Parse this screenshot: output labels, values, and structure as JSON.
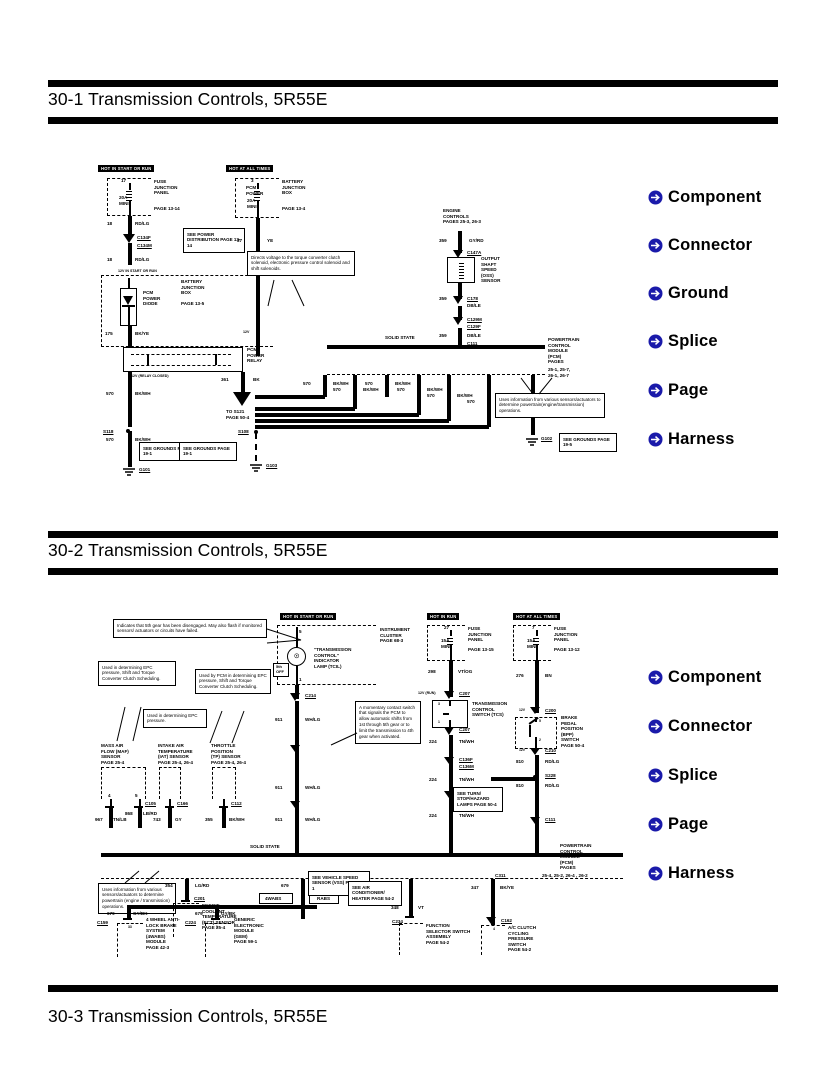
{
  "document": {
    "sections": [
      {
        "id": "30-1",
        "title": "30-1 Transmission Controls, 5R55E"
      },
      {
        "id": "30-2",
        "title": "30-2 Transmission Controls, 5R55E"
      },
      {
        "id": "30-3",
        "title": "30-3 Transmission Controls, 5R55E"
      }
    ]
  },
  "legend_top": {
    "items": [
      {
        "label": "Component"
      },
      {
        "label": "Connector"
      },
      {
        "label": "Ground"
      },
      {
        "label": "Splice"
      },
      {
        "label": "Page"
      },
      {
        "label": "Harness"
      }
    ],
    "bullet_icon": "arrow-circle-icon",
    "bullet_color": "#1a1aaa"
  },
  "legend_bottom": {
    "items": [
      {
        "label": "Component"
      },
      {
        "label": "Connector"
      },
      {
        "label": "Splice"
      },
      {
        "label": "Page"
      },
      {
        "label": "Harness"
      }
    ],
    "bullet_icon": "arrow-circle-icon",
    "bullet_color": "#1a1aaa"
  },
  "diagram1": {
    "hot_labels": {
      "start_or_run": "HOT IN START OR RUN",
      "all_times": "HOT AT ALL TIMES"
    },
    "fuse_junction_panel": {
      "name": "FUSE\nJUNCTION\nPANEL",
      "page": "PAGE 13-14",
      "fuse_num": "17",
      "fuse_rating": "20A\nMINI"
    },
    "battery_junction_box_top": {
      "name": "BATTERY\nJUNCTION\nBOX",
      "page": "PAGE 13-4",
      "fuse_num": "3",
      "fuse_label": "PCM\nPOWER",
      "fuse_rating": "20A\nMINI"
    },
    "see_power_distribution": "SEE POWER\nDISTRIBUTION\nPAGE 13-14",
    "battery_junction_box_diode": {
      "name": "BATTERY\nJUNCTION\nBOX",
      "page": "PAGE 13-5"
    },
    "pcm_power_diode": "PCM\nPOWER\nDIODE",
    "pcm_power_relay": "PCM\nPOWER\nRELAY",
    "engine_controls": "ENGINE\nCONTROLS\nPAGES 25-3, 26-3",
    "oss_sensor": "OUTPUT\nSHAFT\nSPEED\n(OSS)\nSENSOR",
    "pcm": {
      "name": "POWERTRAIN\nCONTROL\nMODULE\n(PCM)\nPAGES",
      "pages": "25-1, 25-7,\n26-1, 26-7"
    },
    "solid_state_label": "SOLID STATE",
    "note_directs_voltage": "Directs voltage to the torque converter clutch solenoid, electronic pressure control solenoid and shift solenoids.",
    "note_uses_information": "Uses information from various sensors/actuators to determine powertrain(engine/transmission) operations.",
    "see_grounds_1": "SEE GROUNDS\nPAGE 19-1",
    "see_grounds_2": "SEE GROUNDS\nPAGE 19-1",
    "see_grounds_3": "SEE GROUNDS\nPAGE 19-5",
    "to_s121": "TO S121\nPAGE 50-4",
    "hot_start_run_inline": "12V IN START OR RUN",
    "relay_closed_label": "12V (RELAY CLOSED)",
    "wires": [
      {
        "num": "18",
        "color": "RD/LG"
      },
      {
        "num": "18",
        "color": "RD/LG"
      },
      {
        "num": "175",
        "color": "BK/YE"
      },
      {
        "num": "37",
        "color": "YE"
      },
      {
        "num": "359",
        "color": "GY/RD"
      },
      {
        "num": "359",
        "color": "DB/LE"
      },
      {
        "num": "359",
        "color": "DB/LE"
      },
      {
        "num": "361",
        "color": "BK"
      },
      {
        "num": "570",
        "color": "BK/WH"
      },
      {
        "num": "570",
        "color": "BK/WH"
      },
      {
        "num": "570",
        "color": "BK/WH"
      },
      {
        "num": "570",
        "color": "BK/WH"
      },
      {
        "num": "570",
        "color": "BK/WH"
      },
      {
        "num": "570",
        "color": "BK/WH"
      },
      {
        "num": "570",
        "color": "BK/WH"
      },
      {
        "num": "570",
        "color": "BK/WH"
      },
      {
        "num": "570",
        "color": "BK/WH"
      },
      {
        "num": "57",
        "color": "BK"
      }
    ],
    "connectors": [
      "C134F",
      "C134M",
      "C147A",
      "C178",
      "C129M",
      "C129F",
      "C111",
      "C111"
    ],
    "splices": [
      "S118",
      "S108"
    ],
    "grounds": [
      "G101",
      "G103",
      "G102"
    ]
  },
  "diagram2": {
    "hot_labels": {
      "start_or_run": "HOT IN START OR RUN",
      "in_run": "HOT IN RUN",
      "all_times": "HOT AT ALL TIMES"
    },
    "note_tcil": "Indicates that 5th gear has been disengaged.  May also flash if monitored sensors/ actuators or circuits have failed.",
    "note_epc_left": "Used in determining EPC pressure, Shift and Torque Converter Clutch Scheduling.",
    "note_epc_mid": "Used by PCM in determining EPC pressure, Shift and Torque Converter Clutch Scheduling.",
    "note_iat": "Used in determining EPC pressure.",
    "note_momentary": "A momentary contact switch that signals the PCM to allow automatic shifts from 1st through 5th gear or to limit the transmission to 4th gear when activated.",
    "note_uses_information": "Uses information from various sensors/actuators to determine powertrain (engine / transmission) operations.",
    "instrument_cluster": "INSTRUMENT\nCLUSTER\nPAGE 68-3",
    "tcil": "\"TRANSMISSION\nCONTROL\"\nINDICATOR\nLAMP (TCIL)",
    "tcil_state": "5th\nOFF",
    "maf_sensor": "MASS AIR\nFLOW (MAF)\nSENSOR\nPAGE 25-4",
    "iat_sensor": "INTAKE AIR\nTEMPERATURE\n(IAT) SENSOR\nPAGE 25-4, 26-4",
    "tp_sensor": "THROTTLE\nPOSITION\n(TP) SENSOR\nPAGE 25-4, 26-4",
    "fuse_junction_panel_run": {
      "name": "FUSE\nJUNCTION\nPANEL",
      "page": "PAGE 13-15",
      "fuse_num": "27",
      "fuse_rating": "15A\nMINI"
    },
    "fuse_junction_panel_all": {
      "name": "FUSE\nJUNCTION\nPANEL",
      "page": "PAGE 13-12",
      "fuse_num": "7",
      "fuse_rating": "15A\nMINI"
    },
    "tcs": "TRANSMISSION\nCONTROL\nSWITCH (TCS)",
    "bpp_switch": "BRAKE\nPEDAL\nPOSITION\n(BPP)\nSWITCH\nPAGE 50-4",
    "see_turn_stop": "SEE TURN/\nSTOP/HAZARD\nLAMPS\nPAGE 50-4",
    "pcm": {
      "name": "POWERTRAIN\nCONTROL\nMODULE\n(PCM)\nPAGES",
      "pages": "25-4, 25-2, 26-4 , 26-2"
    },
    "solid_state_label": "SOLID STATE",
    "ect_sensor": "ENGINE\nCOOLANT\nTEMPERATURE\n(ECT) SENSOR\nPAGE 25-4",
    "abs_module": "4 WHEEL ANTI-\nLOCK BRAKE\nSYSTEM\n(4WABS)\nMODULE\nPAGE 42-3",
    "gem_module": "GENERIC\nELECTRONIC\nMODULE\n(GEM)\nPAGE 59-1",
    "see_vss": "SEE VEHICLE\nSPEED SENSOR\n(VSS)\nPAGE 64-1",
    "see_ac_heater": "SEE AIR\nCONDITIONER/\nHEATER\nPAGE 54-2",
    "function_selector": "FUNCTION\nSELECTOR SWITCH\nASSEMBLY\nPAGE 54-2",
    "ac_clutch": "A/C CLUTCH\nCYCLING\nPRESSURE\nSWITCH\nPAGE 54-2",
    "tag_4wabs": "4WABS",
    "tag_rabs": "RABS",
    "wires": [
      {
        "num": "911",
        "color": "WH/LG"
      },
      {
        "num": "911",
        "color": "WH/LG"
      },
      {
        "num": "911",
        "color": "WH/LG"
      },
      {
        "num": "967",
        "color": "TN/LB"
      },
      {
        "num": "868",
        "color": "LB/RD"
      },
      {
        "num": "743",
        "color": "GY"
      },
      {
        "num": "355",
        "color": "BK/WH"
      },
      {
        "num": "298",
        "color": "VT/OG"
      },
      {
        "num": "276",
        "color": "BN"
      },
      {
        "num": "224",
        "color": "TN/WH"
      },
      {
        "num": "224",
        "color": "TN/WH"
      },
      {
        "num": "224",
        "color": "TN/WH"
      },
      {
        "num": "511",
        "color": "LB/RD"
      },
      {
        "num": "810",
        "color": "RD/LG"
      },
      {
        "num": "810",
        "color": "RD/LG"
      },
      {
        "num": "679",
        "color": "GY/BK"
      },
      {
        "num": "679",
        "color": "GY/BK"
      },
      {
        "num": "679",
        "color": "GY/BK"
      },
      {
        "num": "679",
        "color": "GY/BK"
      },
      {
        "num": "354",
        "color": "LG/RD"
      },
      {
        "num": "348",
        "color": "VT"
      },
      {
        "num": "347",
        "color": "BK/YE"
      }
    ],
    "connectors": [
      "C214",
      "C105",
      "C166",
      "C112",
      "C207",
      "C207",
      "C136F",
      "C136M",
      "C124M",
      "C124F",
      "C111",
      "C200",
      "C210",
      "C201",
      "C159",
      "C224",
      "C234",
      "C311",
      "C162"
    ],
    "splices": [
      "S228"
    ]
  }
}
